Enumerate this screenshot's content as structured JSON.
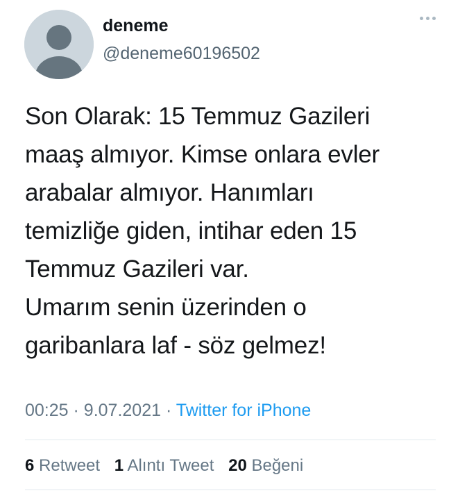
{
  "author": {
    "display_name": "deneme",
    "handle": "@deneme60196502"
  },
  "icons": {
    "avatar": "default-avatar-icon",
    "more": "more-options-icon"
  },
  "tweet": {
    "lines": [
      "Son Olarak: 15 Temmuz Gazileri",
      "maaş almıyor. Kimse onlara evler",
      "arabalar almıyor. Hanımları",
      "temizliğe giden, intihar eden 15",
      "Temmuz Gazileri var.",
      "Umarım senin üzerinden o",
      "garibanlara laf - söz gelmez!"
    ],
    "time": "00:25",
    "separator": "·",
    "date": "9.07.2021",
    "source": "Twitter for iPhone"
  },
  "stats": {
    "retweets": {
      "count": "6",
      "label": "Retweet"
    },
    "quotes": {
      "count": "1",
      "label": "Alıntı Tweet"
    },
    "likes": {
      "count": "20",
      "label": "Beğeni"
    }
  },
  "colors": {
    "accent": "#1d9bf0",
    "secondary_text": "#657786",
    "avatar_bg": "#ccd6dd"
  }
}
